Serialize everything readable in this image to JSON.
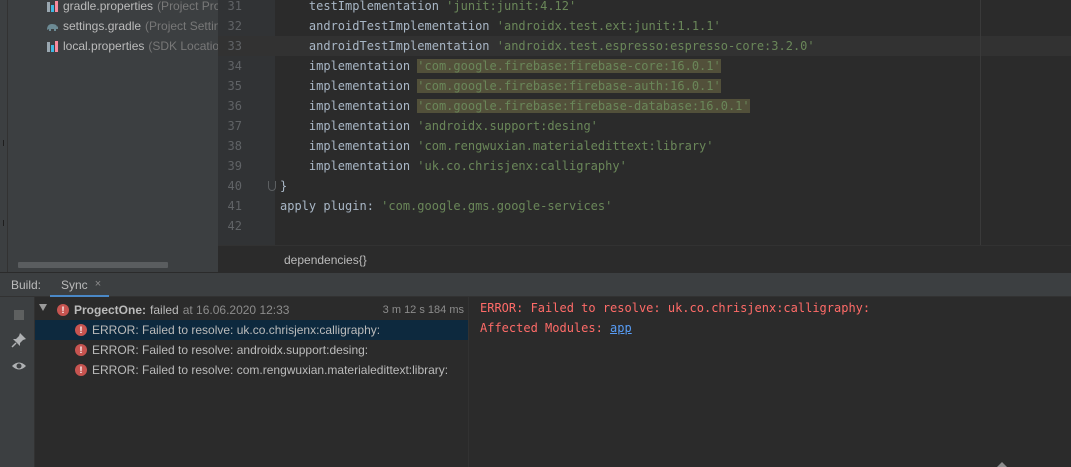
{
  "project_tree": {
    "items": [
      {
        "name": "gradle.properties",
        "desc": "(Project Pro",
        "icon": "gradle-properties-icon"
      },
      {
        "name": "settings.gradle",
        "desc": "(Project Settin",
        "icon": "gradle-elephant-icon"
      },
      {
        "name": "local.properties",
        "desc": "(SDK Location",
        "icon": "properties-icon"
      }
    ]
  },
  "editor": {
    "lines": [
      {
        "n": "31",
        "a": "    testImplementation ",
        "s": "'junit:junit:4.12'",
        "b": ""
      },
      {
        "n": "32",
        "a": "    androidTestImplementation ",
        "s": "'androidx.test.ext:junit:1.1.1'",
        "b": ""
      },
      {
        "n": "33",
        "a": "    androidTestImplementation ",
        "s": "'androidx.test.espresso:espresso-core:3.2.0'",
        "b": ""
      },
      {
        "n": "34",
        "a": "    implementation ",
        "s": "",
        "h": "'com.google.firebase:firebase-core:16.0.1'",
        "b": ""
      },
      {
        "n": "35",
        "a": "    implementation ",
        "s": "",
        "h": "'com.google.firebase:firebase-auth:16.0.1'",
        "b": ""
      },
      {
        "n": "36",
        "a": "    implementation ",
        "s": "",
        "h": "'com.google.firebase:firebase-database:16.0.1'",
        "b": ""
      },
      {
        "n": "37",
        "a": "    implementation ",
        "s": "'androidx.support:desing'",
        "b": ""
      },
      {
        "n": "38",
        "a": "    implementation ",
        "s": "'com.rengwuxian.materialedittext:library'",
        "b": ""
      },
      {
        "n": "39",
        "a": "    implementation ",
        "s": "'uk.co.chrisjenx:calligraphy'",
        "b": ""
      },
      {
        "n": "40",
        "a": "}",
        "s": "",
        "b": ""
      },
      {
        "n": "41",
        "a": "apply plugin: ",
        "s": "'com.google.gms.google-services'",
        "b": ""
      },
      {
        "n": "42",
        "a": "",
        "s": "",
        "b": ""
      }
    ],
    "breadcrumb": "dependencies{}",
    "colors": {
      "string": "#6a8759",
      "highlight": "#52503a",
      "text": "#a9b7c6"
    }
  },
  "build_panel": {
    "label": "Build:",
    "tab": "Sync",
    "tab_close": "×"
  },
  "build_tree": {
    "root": {
      "name": "ProgectOne:",
      "status": "failed",
      "time": "at 16.06.2020 12:33",
      "duration": "3 m 12 s 184 ms"
    },
    "errors": [
      "ERROR: Failed to resolve: uk.co.chrisjenx:calligraphy:",
      "ERROR: Failed to resolve: androidx.support:desing:",
      "ERROR: Failed to resolve: com.rengwuxian.materialedittext:library:"
    ]
  },
  "console": {
    "line1": "ERROR: Failed to resolve: uk.co.chrisjenx:calligraphy:",
    "line2_prefix": "Affected Modules: ",
    "line2_link": "app",
    "colors": {
      "error": "#ff6b68",
      "link": "#589df6"
    }
  },
  "tools": [
    "stop-icon",
    "pin-icon",
    "eye-icon"
  ]
}
